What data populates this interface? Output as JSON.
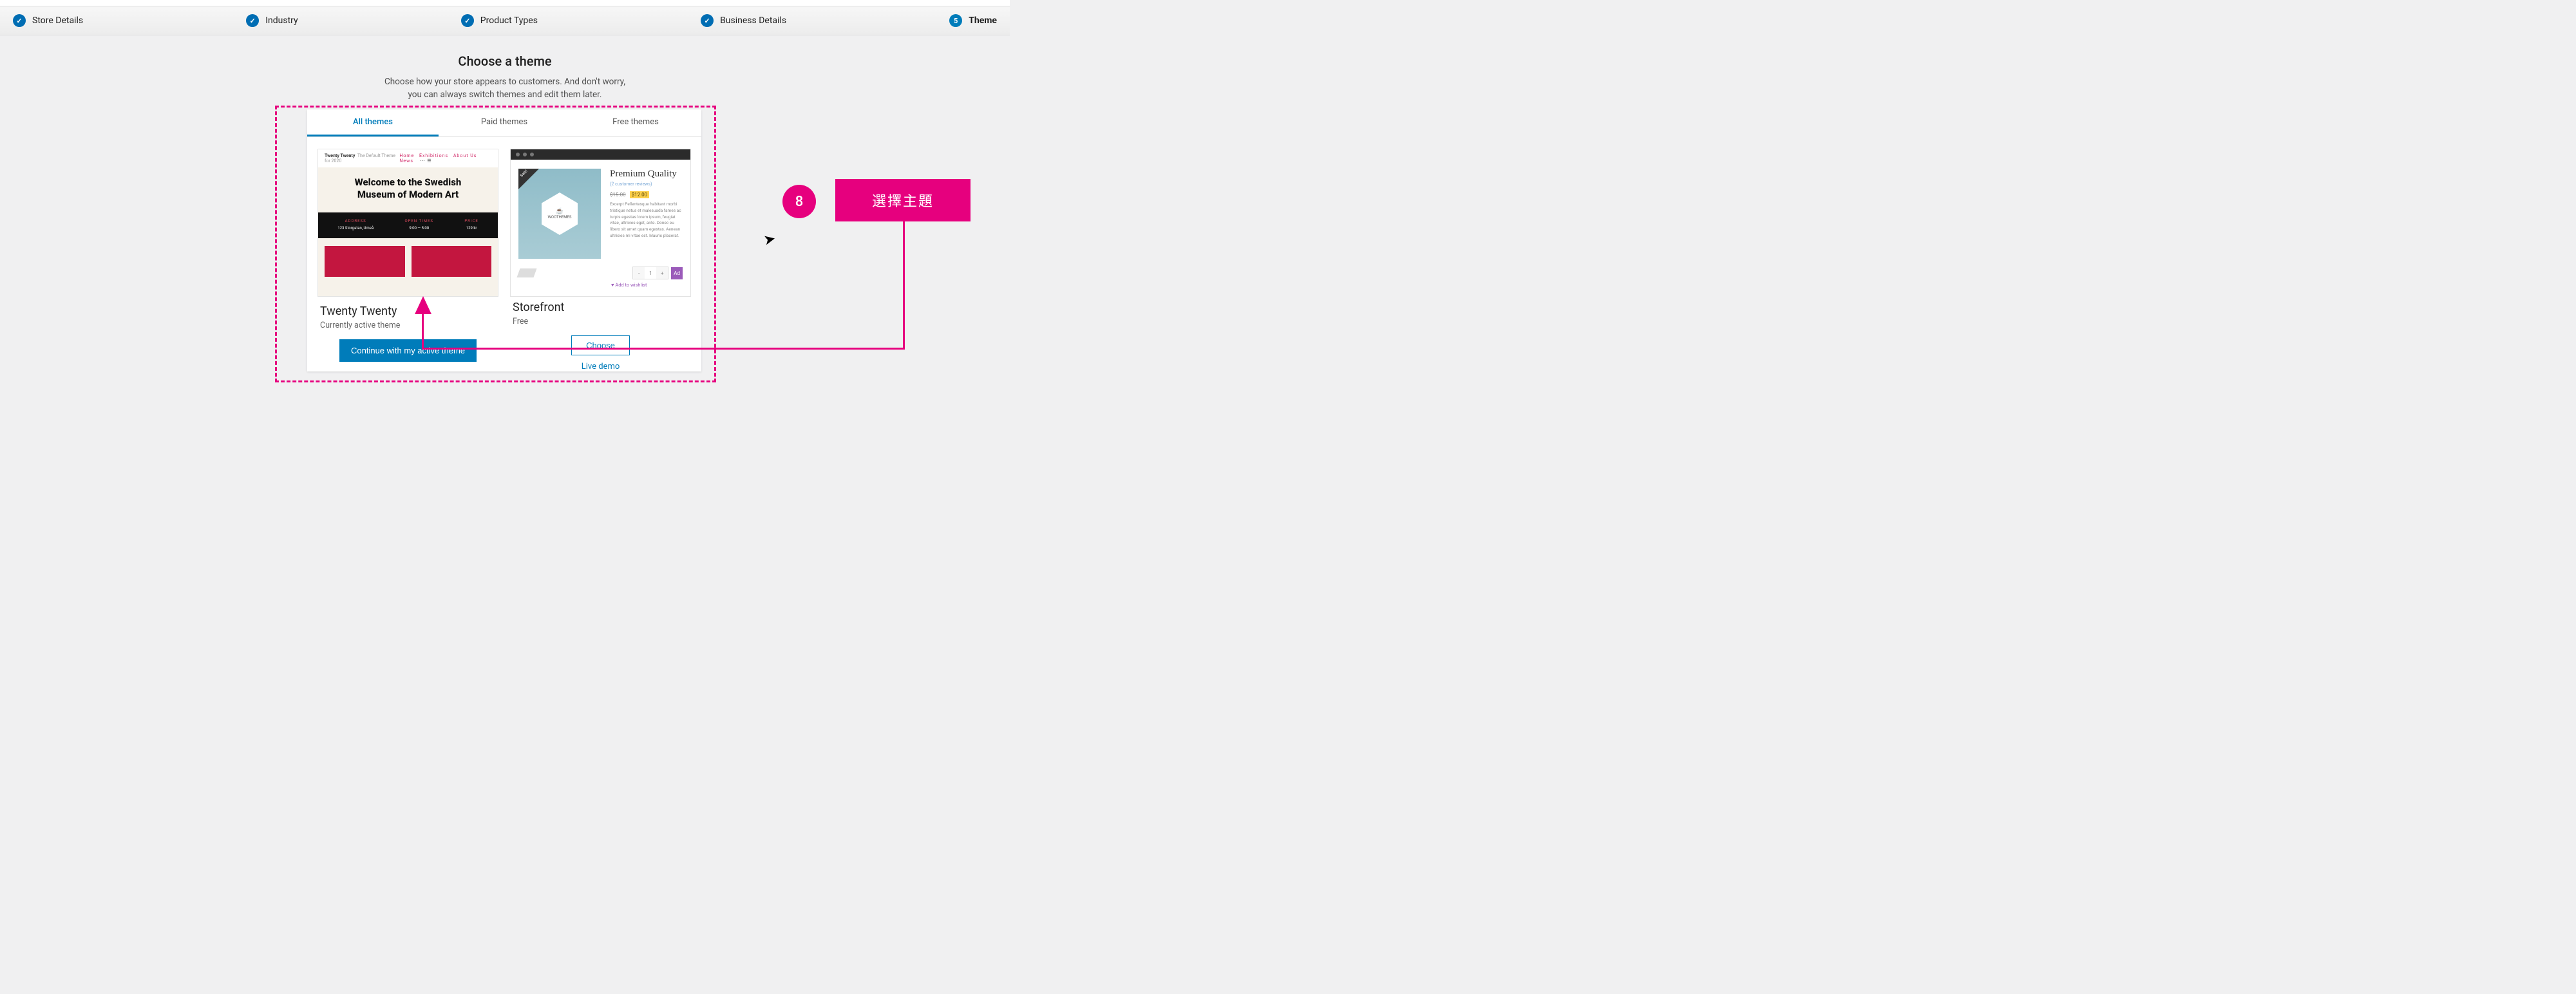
{
  "stepper": {
    "items": [
      {
        "label": "Store Details",
        "done": true
      },
      {
        "label": "Industry",
        "done": true
      },
      {
        "label": "Product Types",
        "done": true
      },
      {
        "label": "Business Details",
        "done": true
      },
      {
        "label": "Theme",
        "done": false,
        "number": "5",
        "current": true
      }
    ]
  },
  "header": {
    "title": "Choose a theme",
    "subtitle1": "Choose how your store appears to customers. And don't worry,",
    "subtitle2": "you can always switch themes and edit them later."
  },
  "tabs": {
    "all": "All themes",
    "paid": "Paid themes",
    "free": "Free themes"
  },
  "theme_left": {
    "brand": "Twenty Twenty",
    "tag": "The Default Theme for 2020",
    "nav": {
      "a": "Home",
      "b": "Exhibitions",
      "c": "About Us",
      "d": "News"
    },
    "hero1": "Welcome to the Swedish",
    "hero2": "Museum of Modern Art",
    "band": {
      "c1l": "ADDRESS",
      "c1": "123 Storgatan, Umeå",
      "c2l": "OPEN TIMES",
      "c2": "9:00 — 5:00",
      "c3l": "PRICE",
      "c3": "129 kr"
    },
    "name": "Twenty Twenty",
    "status": "Currently active theme",
    "cta": "Continue with my active theme"
  },
  "theme_right": {
    "prod_title": "Premium Quality",
    "reviews": "(2 customer reviews)",
    "price_old": "$15.00",
    "price_new": "$12.00",
    "desc": "Excerpt Pellentesque habitant morbi tristique netus et malesuada fames ac turpis egestas lorem ipsum, feugiat vitae, ultricies eget, ante. Donec eu libero sit amet quam egestas. Aenean ultricies mi vitae est. Mauris placerat.",
    "qty": "1",
    "add": "Ad",
    "wish": "Add to wishlist",
    "sale": "Sale!",
    "logo": "WOOTHEMES",
    "name": "Storefront",
    "price": "Free",
    "choose": "Choose",
    "demo": "Live demo"
  },
  "annotation": {
    "num": "8",
    "label": "選擇主題"
  }
}
